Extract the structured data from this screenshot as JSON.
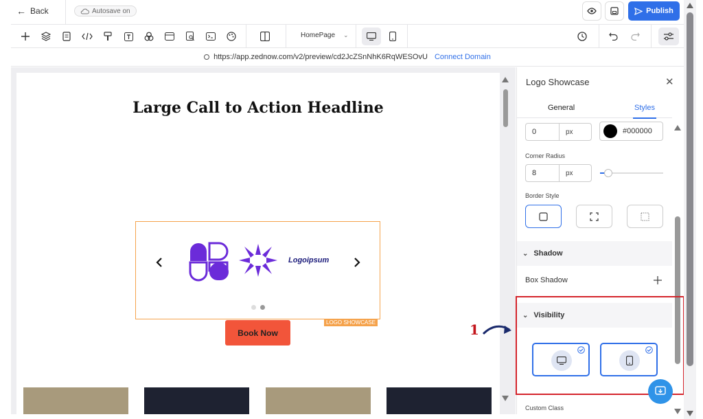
{
  "header": {
    "back_label": "Back",
    "autosave_label": "Autosave on",
    "publish_label": "Publish"
  },
  "toolbar": {
    "page_selector": "HomePage"
  },
  "urlbar": {
    "url": "https://app.zednow.com/v2/preview/cd2JcZSnNhK6RqWESOvU",
    "connect_label": "Connect Domain"
  },
  "canvas": {
    "headline": "Large Call to Action Headline",
    "logo_text": "Logoipsum",
    "logo_tag": "LOGO SHOWCASE",
    "cta_label": "Book Now"
  },
  "panel": {
    "title": "Logo Showcase",
    "tabs": [
      {
        "label": "General"
      },
      {
        "label": "Styles"
      }
    ],
    "border_width": {
      "value": "0",
      "unit": "px"
    },
    "border_color": "#000000",
    "corner_radius_label": "Corner Radius",
    "corner_radius": {
      "value": "8",
      "unit": "px"
    },
    "border_style_label": "Border Style",
    "shadow_label": "Shadow",
    "box_shadow_label": "Box Shadow",
    "visibility_label": "Visibility",
    "custom_class_label": "Custom Class"
  },
  "annotation": {
    "number": "1"
  },
  "colors": {
    "accent": "#2f6fe8",
    "cta": "#f2553a",
    "highlight": "#d4232a",
    "logo_border": "#f5a24b",
    "logo_purple": "#6b2bd9"
  }
}
